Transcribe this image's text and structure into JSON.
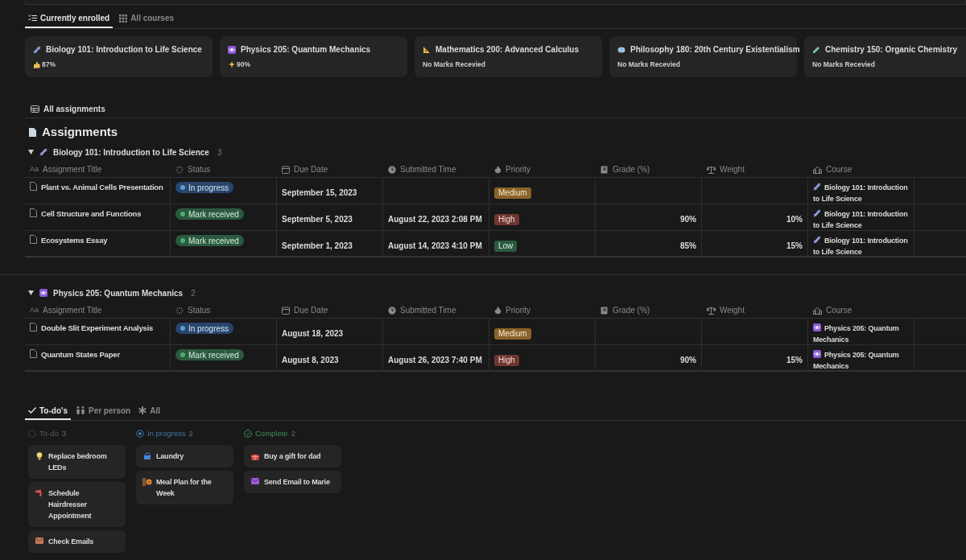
{
  "course_tabs": [
    {
      "label": "Currently enrolled",
      "selected": true
    },
    {
      "label": "All courses",
      "selected": false
    }
  ],
  "courses": [
    {
      "name": "Biology 101: Introduction to Life Science",
      "mark": "87%"
    },
    {
      "name": "Physics 205: Quantum Mechanics",
      "mark": "90%"
    },
    {
      "name": "Mathematics 200: Advanced Calculus",
      "mark": "No Marks Recevied"
    },
    {
      "name": "Philosophy 180: 20th Century Existentialism",
      "mark": "No Marks Recevied"
    },
    {
      "name": "Chemistry 150: Organic Chemistry",
      "mark": "No Marks Recevied"
    }
  ],
  "view_tab": "All assignments",
  "heading": "Assignments",
  "groups": [
    {
      "name": "Biology 101: Introduction to Life Science",
      "count": "3",
      "expanded": true,
      "columns": [
        {
          "icon_text": "Aa",
          "label": "Assignment Title"
        },
        {
          "label": "Status"
        },
        {
          "label": "Due Date"
        },
        {
          "label": "Submitted Time"
        },
        {
          "label": "Priority"
        },
        {
          "label": "Grade (%)"
        },
        {
          "label": "Weight"
        },
        {
          "label": "Course"
        }
      ],
      "rows": [
        {
          "title": "Plant vs. Animal Cells Presentation",
          "status": {
            "kind": "progress",
            "label": "In progress"
          },
          "due": "September 15, 2023",
          "submitted": "",
          "priority": {
            "kind": "medium",
            "label": "Medium"
          },
          "grade": "",
          "weight": "",
          "course": "Biology 101: Introduction to Life Science"
        },
        {
          "title": "Cell Structure and Functions",
          "status": {
            "kind": "done",
            "label": "Mark received"
          },
          "due": "September 5, 2023",
          "submitted": "August 22, 2023 2:08 PM",
          "priority": {
            "kind": "high",
            "label": "High"
          },
          "grade": "90%",
          "weight": "10%",
          "course": "Biology 101: Introduction to Life Science"
        },
        {
          "title": "Ecosystems Essay",
          "status": {
            "kind": "done",
            "label": "Mark received"
          },
          "due": "September 1, 2023",
          "submitted": "August 14, 2023 4:10 PM",
          "priority": {
            "kind": "low",
            "label": "Low"
          },
          "grade": "85%",
          "weight": "15%",
          "course": "Biology 101: Introduction to Life Science"
        }
      ]
    },
    {
      "name": "Physics 205: Quantum Mechanics",
      "count": "2",
      "expanded": true,
      "columns": [
        {
          "icon_text": "Aa",
          "label": "Assignment Title"
        },
        {
          "label": "Status"
        },
        {
          "label": "Due Date"
        },
        {
          "label": "Submitted Time"
        },
        {
          "label": "Priority"
        },
        {
          "label": "Grade (%)"
        },
        {
          "label": "Weight"
        },
        {
          "label": "Course"
        }
      ],
      "rows": [
        {
          "title": "Double Slit Experiment Analysis",
          "status": {
            "kind": "progress",
            "label": "In progress"
          },
          "due": "August 18, 2023",
          "submitted": "",
          "priority": {
            "kind": "medium",
            "label": "Medium"
          },
          "grade": "",
          "weight": "",
          "course": "Physics 205: Quantum Mechanics"
        },
        {
          "title": "Quantum States Paper",
          "status": {
            "kind": "done",
            "label": "Mark received"
          },
          "due": "August 8, 2023",
          "submitted": "August 26, 2023 7:40 PM",
          "priority": {
            "kind": "high",
            "label": "High"
          },
          "grade": "90%",
          "weight": "15%",
          "course": "Physics 205: Quantum Mechanics"
        }
      ]
    }
  ],
  "todo_tabs": [
    {
      "label": "To-do's",
      "selected": true
    },
    {
      "label": "Per person",
      "selected": false
    },
    {
      "label": "All",
      "selected": false
    }
  ],
  "board": [
    {
      "kind": "todo",
      "label": "To-do",
      "count": "3",
      "cards": [
        "Replace bedroom LEDs",
        "Schedule Hairdresser Appointment",
        "Check Emails"
      ]
    },
    {
      "kind": "progress",
      "label": "In progress",
      "count": "2",
      "cards": [
        "Laundry",
        "Meal Plan for the Week"
      ]
    },
    {
      "kind": "complete",
      "label": "Complete",
      "count": "2",
      "cards": [
        "Buy a gift for dad",
        "Send Email to Marie"
      ]
    }
  ]
}
